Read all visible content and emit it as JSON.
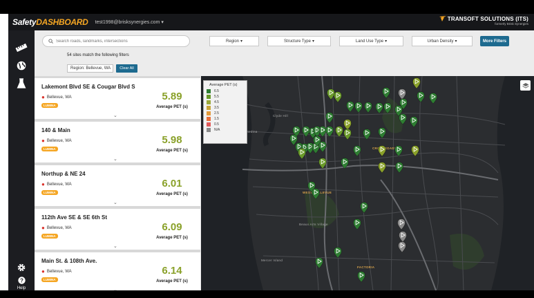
{
  "header": {
    "logo_prefix": "Safety",
    "logo_accent": "DASHBOARD",
    "user_email": "test1998@brisksynergies.com",
    "brand_name": "TRANSOFT SOLUTIONS (ITS)",
    "brand_sub": "formerly Brisk Synergies"
  },
  "nav": {
    "items": [
      "ruler-icon",
      "globe-icon",
      "flask-icon",
      "gear-icon",
      "help-icon"
    ],
    "help_label": "Help"
  },
  "filters": {
    "search_placeholder": "Search roads, landmarks, intersections",
    "dropdowns": [
      "Region",
      "Structure Type",
      "Land Use Type",
      "Urban Density"
    ],
    "more_filters": "More Filters",
    "match_text": "54 sites match the following filters",
    "active_chip": "Region: Bellevue, WA",
    "clear_all": "Clear All"
  },
  "sites": [
    {
      "name": "Lakemont Blvd SE & Cougar Blvd S",
      "location": "Bellevue, WA",
      "badge": "LUMINA",
      "value": "5.89",
      "value_label": "Average PET (s)"
    },
    {
      "name": "140 & Main",
      "location": "Bellevue, WA",
      "badge": "LUMINA",
      "value": "5.98",
      "value_label": "Average PET (s)"
    },
    {
      "name": "Northup & NE 24",
      "location": "Bellevue, WA",
      "badge": "LUMINA",
      "value": "6.01",
      "value_label": "Average PET (s)"
    },
    {
      "name": "112th Ave SE & SE 6th St",
      "location": "Bellevue, WA",
      "badge": "LUMINA",
      "value": "6.09",
      "value_label": "Average PET (s)"
    },
    {
      "name": "Main St. & 108th Ave.",
      "location": "Bellevue, WA",
      "badge": "LUMINA",
      "value": "6.14",
      "value_label": "Average PET (s)"
    }
  ],
  "map": {
    "legend_title": "Average PET (s)",
    "legend": [
      {
        "label": "6.5",
        "color": "#2e7d32"
      },
      {
        "label": "5.5",
        "color": "#6a9a2a"
      },
      {
        "label": "4.5",
        "color": "#9aa83a"
      },
      {
        "label": "3.5",
        "color": "#c9a63a"
      },
      {
        "label": "2.5",
        "color": "#e39a3a"
      },
      {
        "label": "1.5",
        "color": "#e8703a"
      },
      {
        "label": "0.5",
        "color": "#e05a5a"
      },
      {
        "label": "N/A",
        "color": "#8a8a8a"
      }
    ],
    "labels": {
      "crossroads": "CROSSROADS",
      "west_bellevue": "WEST BELLEVUE",
      "factoria": "FACTORIA",
      "clyde_hill": "Clyde Hill",
      "medina": "Medina",
      "beaux_arts": "Beaux Arts Village",
      "mercer_island": "Mercer Island"
    },
    "marker_colors": {
      "dark": "#2e7d32",
      "mid": "#6a9a2a",
      "light": "#8aa12a",
      "na": "#8a8a8a"
    }
  }
}
